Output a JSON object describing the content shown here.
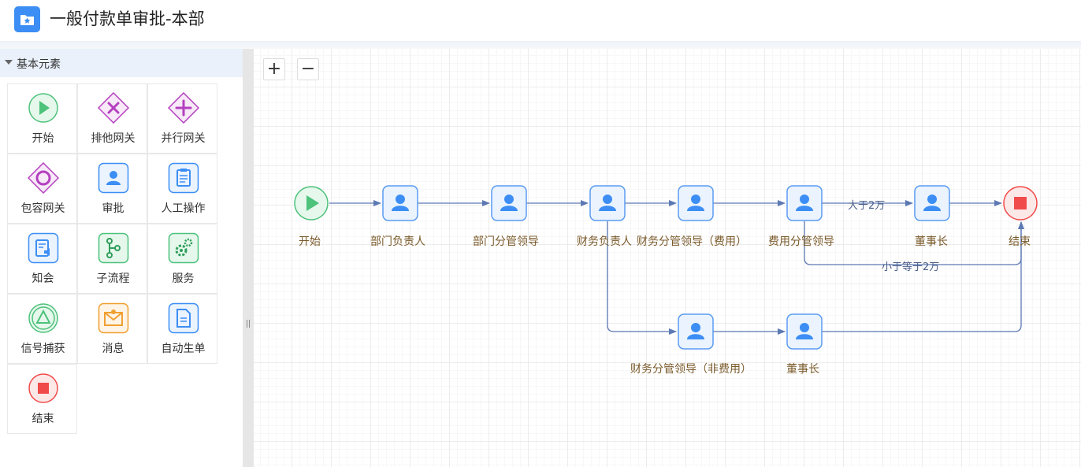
{
  "header": {
    "title": "一般付款单审批-本部",
    "logo_icon": "folder-star-icon"
  },
  "sidebar": {
    "section_title": "基本元素",
    "tiles": [
      {
        "label": "开始",
        "icon": "start-play-icon"
      },
      {
        "label": "排他网关",
        "icon": "exclusive-gateway-icon"
      },
      {
        "label": "并行网关",
        "icon": "parallel-gateway-icon"
      },
      {
        "label": "包容网关",
        "icon": "inclusive-gateway-icon"
      },
      {
        "label": "审批",
        "icon": "user-approval-icon"
      },
      {
        "label": "人工操作",
        "icon": "manual-task-icon"
      },
      {
        "label": "知会",
        "icon": "notify-icon"
      },
      {
        "label": "子流程",
        "icon": "subprocess-icon"
      },
      {
        "label": "服务",
        "icon": "service-gears-icon"
      },
      {
        "label": "信号捕获",
        "icon": "signal-catch-icon"
      },
      {
        "label": "消息",
        "icon": "message-envelope-icon"
      },
      {
        "label": "自动生单",
        "icon": "auto-document-icon"
      },
      {
        "label": "结束",
        "icon": "end-stop-icon"
      }
    ]
  },
  "toolbar": {
    "zoom_in": "+",
    "zoom_out": "−"
  },
  "flow": {
    "nodes": [
      {
        "label": "开始",
        "type": "start"
      },
      {
        "label": "部门负责人",
        "type": "user"
      },
      {
        "label": "部门分管领导",
        "type": "user"
      },
      {
        "label": "财务负责人",
        "type": "user"
      },
      {
        "label": "财务分管领导（费用）",
        "type": "user"
      },
      {
        "label": "费用分管领导",
        "type": "user"
      },
      {
        "label": "董事长",
        "type": "user"
      },
      {
        "label": "结束",
        "type": "end"
      },
      {
        "label": "财务分管领导（非费用）",
        "type": "user"
      },
      {
        "label": "董事长",
        "type": "user"
      }
    ],
    "edge_labels": {
      "gt": "大于2万",
      "le": "小于等于2万"
    }
  },
  "colors": {
    "accent": "#3c8ef5",
    "start": "#4cc27a",
    "end": "#f04a4a",
    "gateway": "#b43fbf",
    "edge": "#5c79b3"
  }
}
